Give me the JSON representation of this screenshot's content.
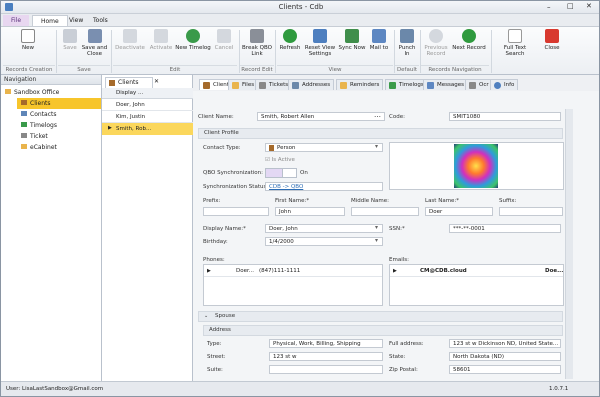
{
  "window": {
    "title": "Clients - Cdb"
  },
  "ribbon_tabs": [
    "File",
    "Home",
    "View",
    "Tools"
  ],
  "ribbon_buttons": {
    "new": "New",
    "save": "Save",
    "save_close": "Save and Close",
    "deactivate": "Deactivate",
    "activate": "Activate",
    "new_timelog": "New Timelog",
    "cancel": "Cancel",
    "break_qbo": "Break QBO Link",
    "refresh": "Refresh",
    "reset_view": "Reset View Settings",
    "sync_now": "Sync Now",
    "mail_to": "Mail to",
    "punch_in": "Punch In",
    "previous_record": "Previous Record",
    "next_record": "Next Record",
    "full_text_search": "Full Text Search",
    "close": "Close"
  },
  "ribbon_groups": [
    "Records Creation",
    "Save",
    "Edit",
    "Record Edit",
    "View",
    "Default",
    "Records Navigation"
  ],
  "navigation": {
    "title": "Navigation",
    "items": [
      "Sandbox Office",
      "Clients",
      "Contacts",
      "Timelogs",
      "Ticket",
      "eCabinet"
    ]
  },
  "doc_tab": "Clients",
  "client_list": {
    "header": "Display ...",
    "rows": [
      "Doer, John",
      "Kim, Justin",
      "Smith, Rob..."
    ]
  },
  "detail_tabs": [
    "Client",
    "Files",
    "Tickets",
    "Addresses",
    "Reminders",
    "Timelogs",
    "Messages",
    "Ocr",
    "Info"
  ],
  "form": {
    "client_name_label": "Client Name:",
    "client_name": "Smith, Robert Allen",
    "code_label": "Code:",
    "code": "SMIT1080",
    "client_profile": "Client Profile",
    "contact_type_label": "Contact Type:",
    "contact_type": "Person",
    "is_active": "Is Active",
    "qbo_sync_label": "QBO Synchronization:",
    "qbo_sync_value": "On",
    "sync_status_label": "Synchronization Status:",
    "sync_status": "CDB -> QBO",
    "prefix_label": "Prefix:",
    "first_name_label": "First Name:*",
    "first_name": "John",
    "middle_name_label": "Middle Name:",
    "last_name_label": "Last Name:*",
    "last_name": "Doer",
    "suffix_label": "Suffix:",
    "display_name_label": "Display Name:*",
    "display_name": "Doer, John",
    "ssn_label": "SSN:*",
    "ssn": "***-**-0001",
    "birthday_label": "Birthday:",
    "birthday": "1/4/2000",
    "phones_label": "Phones:",
    "phone_type": "Doer...",
    "phone": "(847)111-1111",
    "emails_label": "Emails:",
    "email": "CM@CDB.cloud",
    "email_owner": "Doe...",
    "spouse": "Spouse",
    "address": "Address",
    "type_label": "Type:",
    "type": "Physical, Work, Billing, Shipping",
    "full_address_label": "Full address:",
    "full_address": "123 st w Dickinson ND, United State...",
    "street_label": "Street:",
    "street": "123 st w",
    "state_label": "State:",
    "state": "North Dakota (ND)",
    "suite_label": "Suite:",
    "zip_label": "Zip Postal:",
    "zip": "58601"
  },
  "status": {
    "user": "User: LisaLastSandbox@Gmail.com",
    "version": "1.0.7.1"
  },
  "colors": {
    "accent": "#f7c52b",
    "selected": "#fbd75c",
    "ribbon_blue": "#2b6cb5"
  }
}
